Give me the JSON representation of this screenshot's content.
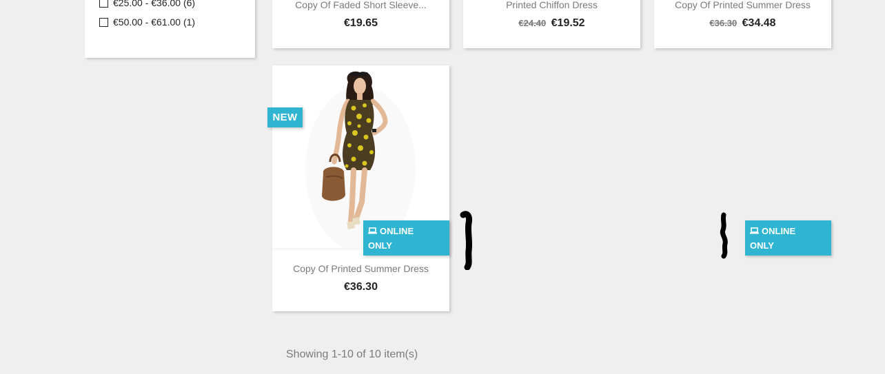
{
  "filters": {
    "price_ranges": [
      {
        "label": "€25.00 - €36.00 (6)",
        "checked": false
      },
      {
        "label": "€50.00 - €61.00 (1)",
        "checked": false
      }
    ]
  },
  "products_top_row": [
    {
      "name": "Copy Of Faded Short Sleeve...",
      "price_old": "",
      "price": "€19.65"
    },
    {
      "name": "Printed Chiffon Dress",
      "price_old": "€24.40",
      "price": "€19.52"
    },
    {
      "name": "Copy Of Printed Summer Dress",
      "price_old": "€36.30",
      "price": "€34.48"
    }
  ],
  "featured_product": {
    "name": "Copy Of Printed Summer Dress",
    "price": "€36.30",
    "flag_new": "NEW",
    "flag_online_line1": "ONLINE",
    "flag_online_line2": "ONLY"
  },
  "orphan_flag": {
    "line1": "ONLINE",
    "line2": "ONLY"
  },
  "pagination": {
    "summary": "Showing 1-10 of 10 item(s)"
  },
  "colors": {
    "accent": "#2fb5d2",
    "background": "#efefef",
    "card": "#ffffff"
  }
}
